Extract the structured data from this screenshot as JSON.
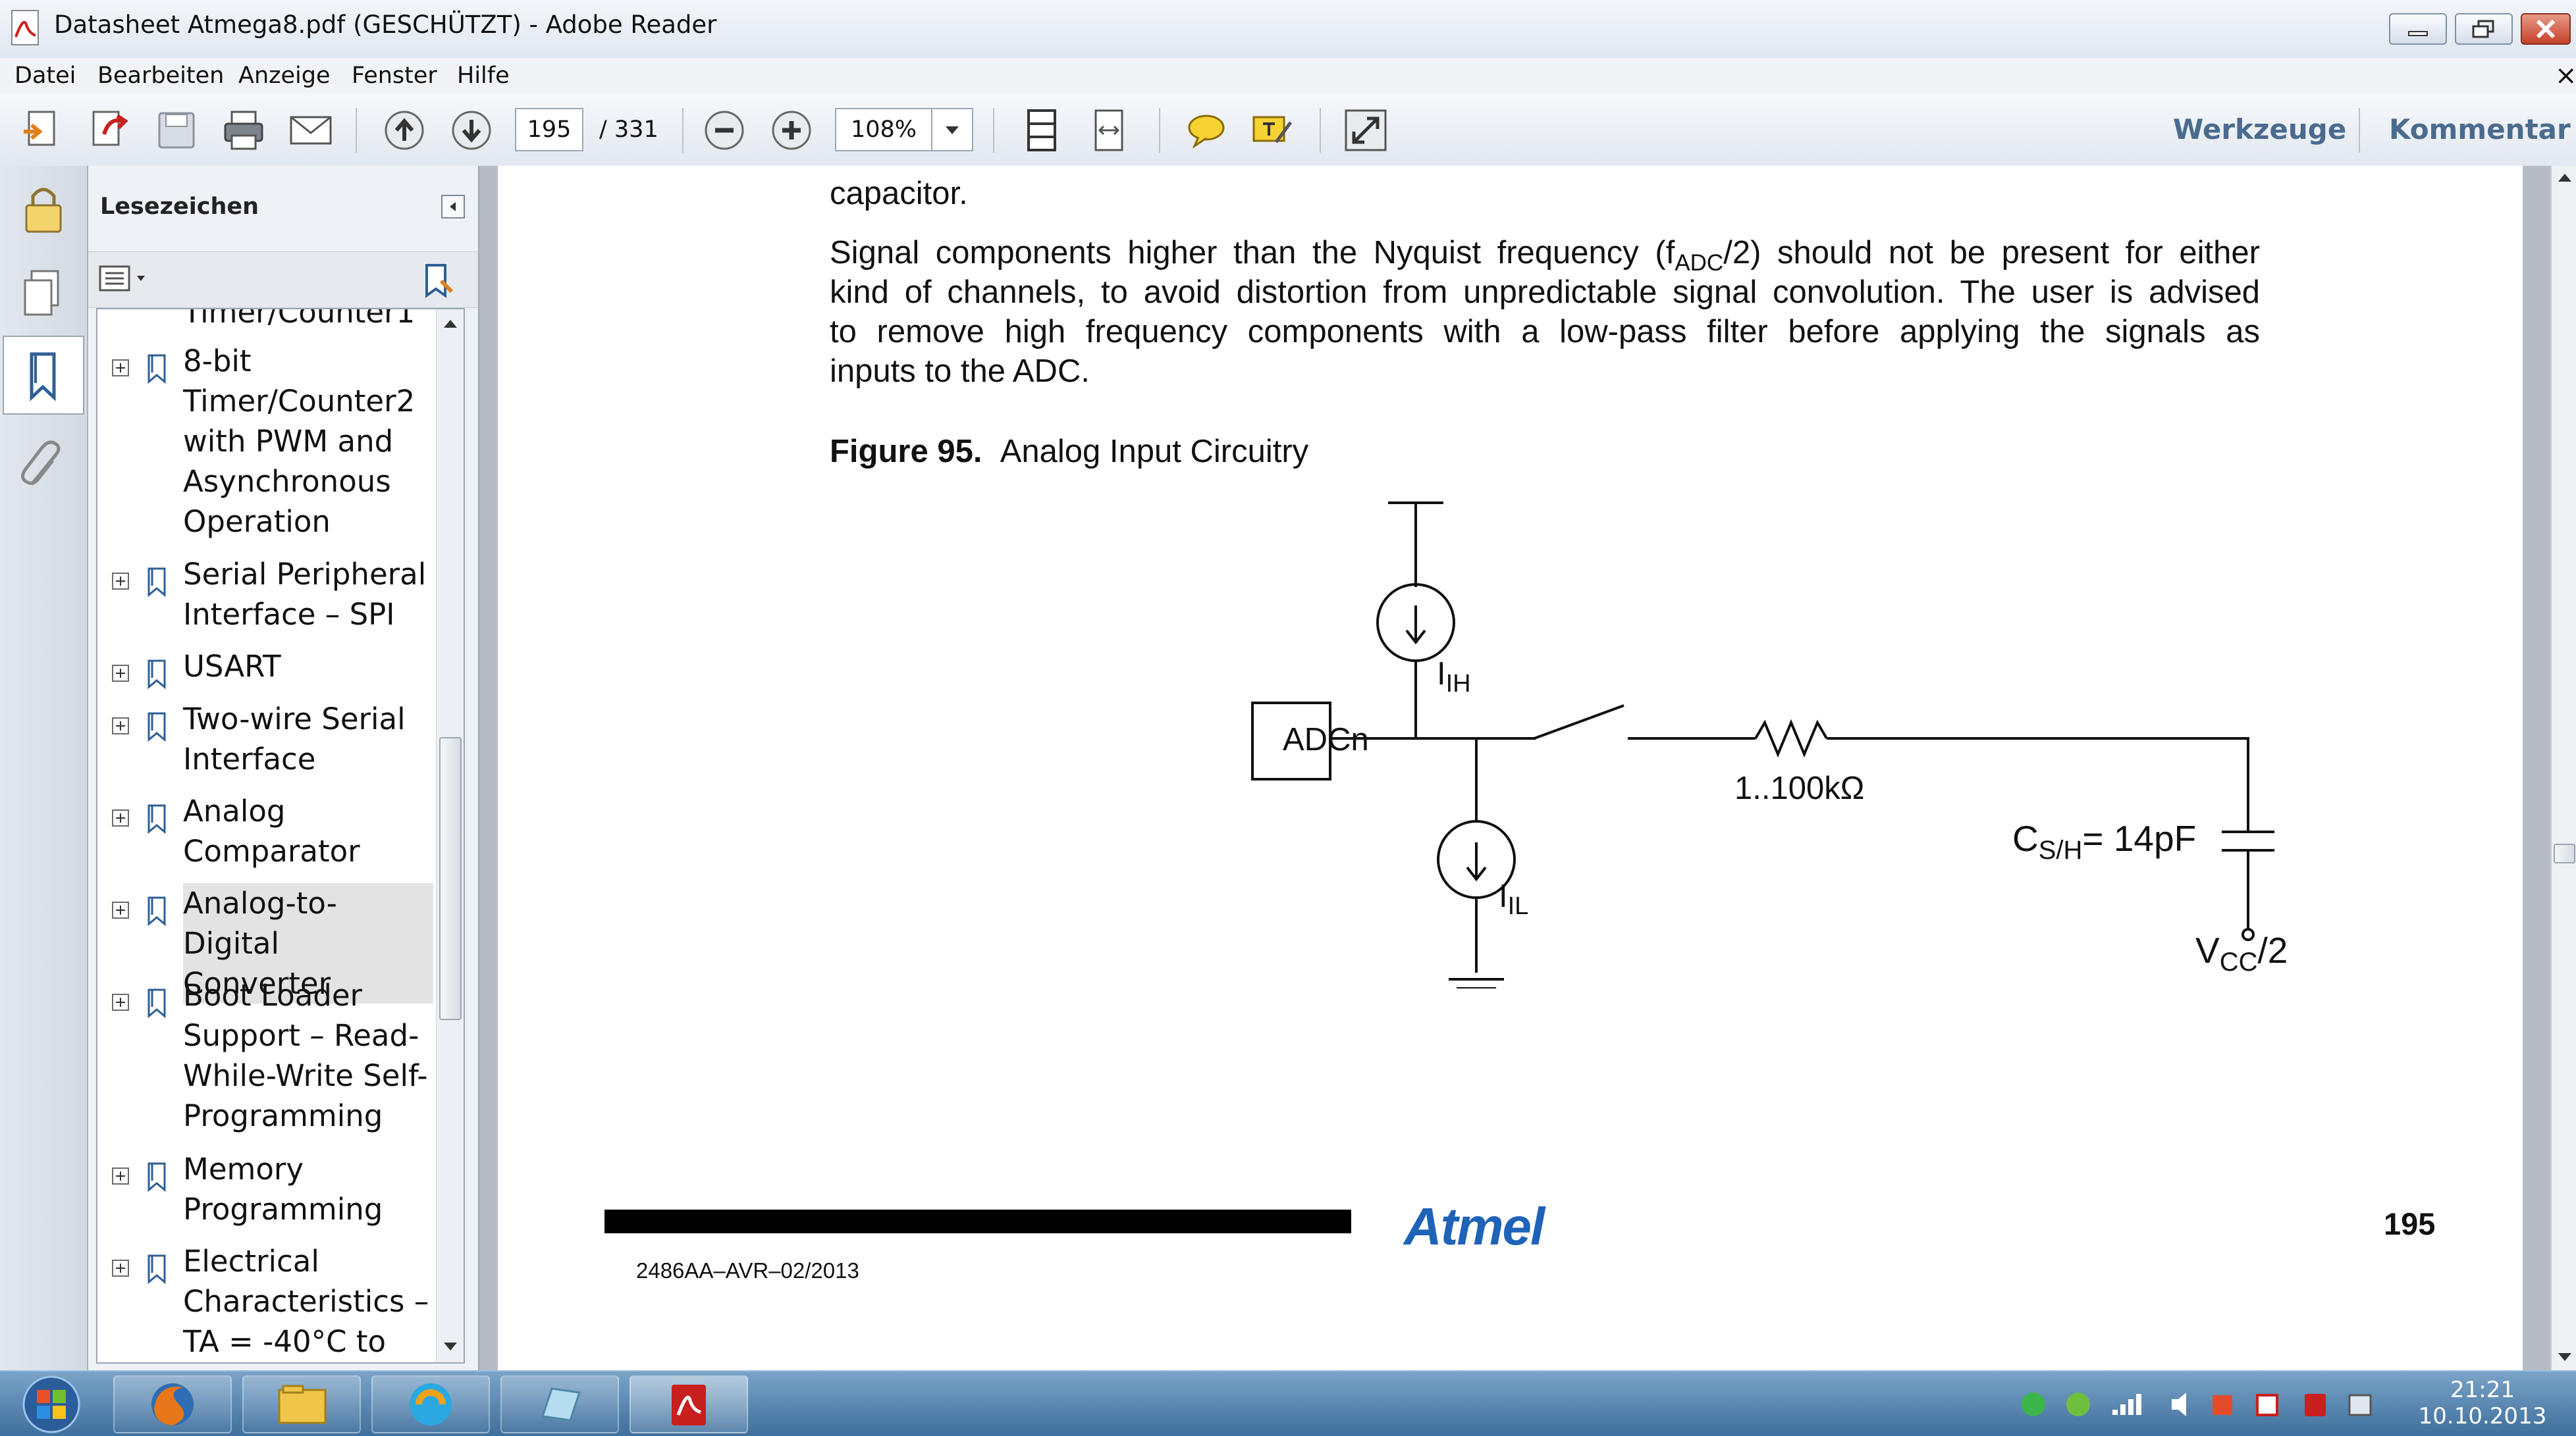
{
  "window": {
    "title": "Datasheet Atmega8.pdf (GESCHÜTZT) - Adobe Reader",
    "close_glyph": "×"
  },
  "menu": [
    "Datei",
    "Bearbeiten",
    "Anzeige",
    "Fenster",
    "Hilfe"
  ],
  "toolbar": {
    "page_current": "195",
    "page_total": "/ 331",
    "zoom": "108%",
    "tools_label": "Werkzeuge",
    "comment_label": "Kommentar"
  },
  "bookmarks": {
    "title": "Lesezeichen",
    "cut_off_top": "Timer/Counter1",
    "items": [
      {
        "label": "8-bit Timer/Counter2 with PWM and Asynchronous Operation",
        "selected": false
      },
      {
        "label": "Serial Peripheral Interface – SPI",
        "selected": false
      },
      {
        "label": "USART",
        "selected": false
      },
      {
        "label": "Two-wire Serial Interface",
        "selected": false
      },
      {
        "label": "Analog Comparator",
        "selected": false
      },
      {
        "label": "Analog-to- Digital Converter",
        "selected": true
      },
      {
        "label": "Boot Loader Support – Read-While-Write Self-Programming",
        "selected": false
      },
      {
        "label": "Memory Programming",
        "selected": false
      },
      {
        "label": "Electrical Characteristics – TA = -40°C to",
        "selected": false
      }
    ]
  },
  "document": {
    "line_capacitor": "capacitor.",
    "para": {
      "l1_a": "Signal components higher than the Nyquist frequency (f",
      "l1_sub": "ADC",
      "l1_b": "/2) should not be present for either",
      "l2": "kind of channels, to avoid distortion from unpredictable signal convolution. The user is advised",
      "l3": "to remove high frequency components with a low-pass filter before applying the signals as",
      "l4": "inputs to the ADC."
    },
    "figure": {
      "number": "Figure 95.",
      "caption": "Analog Input Circuitry",
      "adc_label": "ADCn",
      "iih_main": "I",
      "iih_sub": "IH",
      "iil_main": "I",
      "iil_sub": "IL",
      "resistor": "1..100kΩ",
      "cap_main": "C",
      "cap_sub": "S/H",
      "cap_value": "= 14pF",
      "vcc_main": "V",
      "vcc_sub": "CC",
      "vcc_suffix": "/2"
    },
    "footer": {
      "brand": "Atmel",
      "page_number": "195",
      "doc_code": "2486AA–AVR–02/2013"
    }
  },
  "taskbar": {
    "time": "21:21",
    "date": "10.10.2013"
  },
  "colors": {
    "accent": "#4a6b8e",
    "atmel_blue": "#1e63b8",
    "pdf_red": "#c8201e"
  }
}
